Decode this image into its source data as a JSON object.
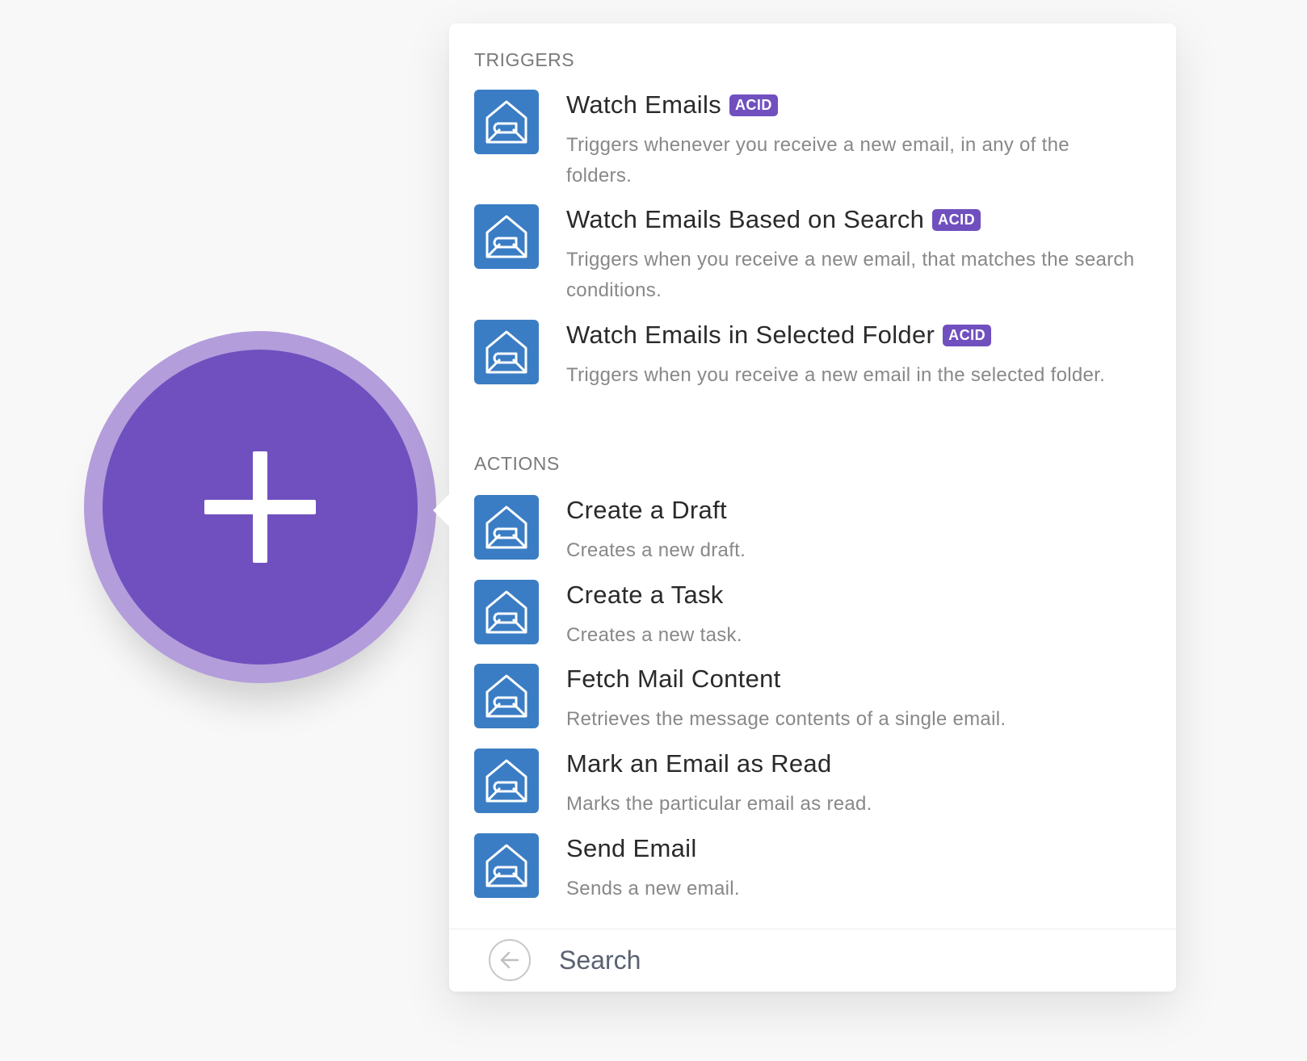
{
  "add_button": {
    "icon": "plus-icon",
    "color": "#7050bf",
    "halo_color": "#b39ddb"
  },
  "app": {
    "icon": "mail-envelope-icon",
    "color": "#3a7dc4"
  },
  "triggers": {
    "label": "TRIGGERS",
    "items": [
      {
        "title": "Watch Emails",
        "badge": "ACID",
        "description": "Triggers whenever you receive a new email, in any of the folders."
      },
      {
        "title": "Watch Emails Based on Search",
        "badge": "ACID",
        "description": "Triggers when you receive a new email, that matches the search conditions."
      },
      {
        "title": "Watch Emails in Selected Folder",
        "badge": "ACID",
        "description": "Triggers when you receive a new email in the selected folder."
      }
    ]
  },
  "actions": {
    "label": "ACTIONS",
    "items": [
      {
        "title": "Create a Draft",
        "description": "Creates a new draft."
      },
      {
        "title": "Create a Task",
        "description": "Creates a new task."
      },
      {
        "title": "Fetch Mail Content",
        "description": "Retrieves the message contents of a single email."
      },
      {
        "title": "Mark an Email as Read",
        "description": "Marks the particular email as read."
      },
      {
        "title": "Send Email",
        "description": "Sends a new email."
      }
    ]
  },
  "footer": {
    "back_icon": "arrow-left-icon",
    "search_placeholder": "Search",
    "search_value": ""
  },
  "badge_color": "#7050bf"
}
